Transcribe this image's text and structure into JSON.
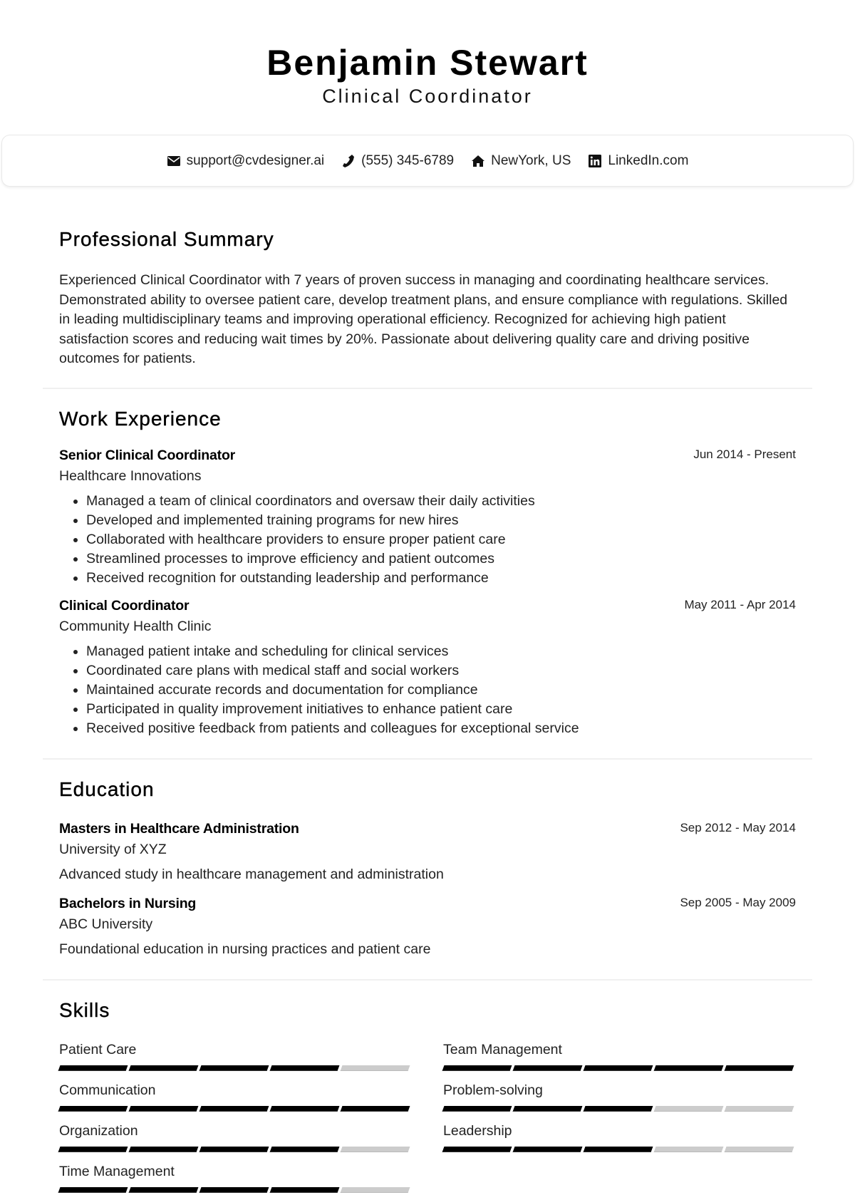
{
  "header": {
    "name": "Benjamin Stewart",
    "title": "Clinical Coordinator"
  },
  "contact": [
    {
      "icon": "envelope-icon",
      "text": "support@cvdesigner.ai"
    },
    {
      "icon": "phone-icon",
      "text": "(555) 345-6789"
    },
    {
      "icon": "home-icon",
      "text": "NewYork, US"
    },
    {
      "icon": "linkedin-icon",
      "text": "LinkedIn.com"
    }
  ],
  "summary": {
    "heading": "Professional Summary",
    "text": "Experienced Clinical Coordinator with 7 years of proven success in managing and coordinating healthcare services. Demonstrated ability to oversee patient care, develop treatment plans, and ensure compliance with regulations. Skilled in leading multidisciplinary teams and improving operational efficiency. Recognized for achieving high patient satisfaction scores and reducing wait times by 20%. Passionate about delivering quality care and driving positive outcomes for patients."
  },
  "experience": {
    "heading": "Work Experience",
    "jobs": [
      {
        "title": "Senior Clinical Coordinator",
        "company": "Healthcare Innovations",
        "dates": "Jun 2014 - Present",
        "bullets": [
          "Managed a team of clinical coordinators and oversaw their daily activities",
          "Developed and implemented training programs for new hires",
          "Collaborated with healthcare providers to ensure proper patient care",
          "Streamlined processes to improve efficiency and patient outcomes",
          "Received recognition for outstanding leadership and performance"
        ]
      },
      {
        "title": "Clinical Coordinator",
        "company": "Community Health Clinic",
        "dates": "May 2011 - Apr 2014",
        "bullets": [
          "Managed patient intake and scheduling for clinical services",
          "Coordinated care plans with medical staff and social workers",
          "Maintained accurate records and documentation for compliance",
          "Participated in quality improvement initiatives to enhance patient care",
          "Received positive feedback from patients and colleagues for exceptional service"
        ]
      }
    ]
  },
  "education": {
    "heading": "Education",
    "items": [
      {
        "degree": "Masters in Healthcare Administration",
        "school": "University of XYZ",
        "dates": "Sep 2012 - May 2014",
        "description": "Advanced study in healthcare management and administration"
      },
      {
        "degree": "Bachelors in Nursing",
        "school": "ABC University",
        "dates": "Sep 2005 - May 2009",
        "description": "Foundational education in nursing practices and patient care"
      }
    ]
  },
  "skills": {
    "heading": "Skills",
    "max_level": 5,
    "items": [
      {
        "name": "Patient Care",
        "level": 4
      },
      {
        "name": "Team Management",
        "level": 5
      },
      {
        "name": "Communication",
        "level": 5
      },
      {
        "name": "Problem-solving",
        "level": 3
      },
      {
        "name": "Organization",
        "level": 4
      },
      {
        "name": "Leadership",
        "level": 3
      },
      {
        "name": "Time Management",
        "level": 4
      }
    ]
  }
}
